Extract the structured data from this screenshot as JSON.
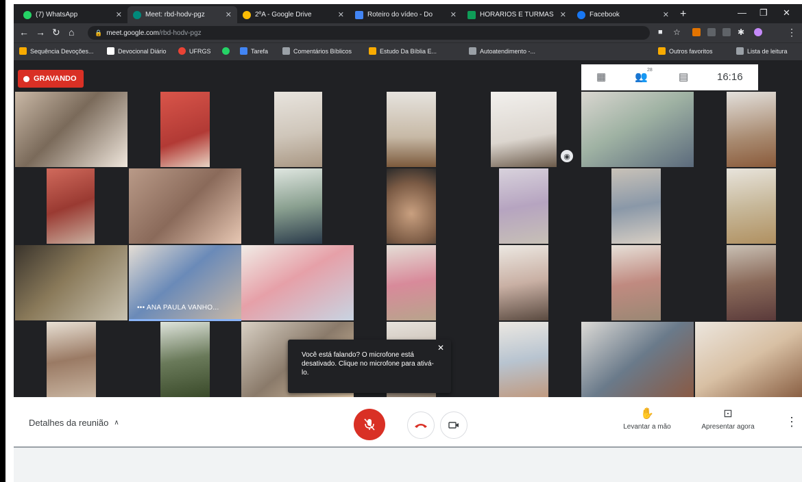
{
  "tabs": [
    {
      "label": "(7) WhatsApp",
      "color": "#25d366",
      "active": false
    },
    {
      "label": "Meet: rbd-hodv-pgz",
      "color": "#00897b",
      "active": true
    },
    {
      "label": "2ºA - Google Drive",
      "color": "#fbbc04",
      "active": false
    },
    {
      "label": "Roteiro do vídeo - Do",
      "color": "#4285f4",
      "active": false
    },
    {
      "label": "HORÁRIOS E TURMAS",
      "color": "#0f9d58",
      "active": false
    },
    {
      "label": "Facebook",
      "color": "#1877f2",
      "active": false
    }
  ],
  "address": {
    "host": "meet.google.com",
    "path": "/rbd-hodv-pgz"
  },
  "bookmarks": [
    {
      "label": "Sequência Devoções...",
      "color": "#f9ab00"
    },
    {
      "label": "Devocional Diário",
      "color": "#ffffff"
    },
    {
      "label": "UFRGS",
      "color": "#ea4335"
    },
    {
      "label": "",
      "color": "#25d366"
    },
    {
      "label": "Tarefa",
      "color": "#4285f4"
    },
    {
      "label": "Comentários Bíblicos",
      "color": "#9aa0a6"
    },
    {
      "label": "Estudo Da Bíblia E...",
      "color": "#f9ab00"
    },
    {
      "label": "Autoatendimento -...",
      "color": "#9aa0a6"
    },
    {
      "label": "Outros favoritos",
      "color": "#f9ab00"
    },
    {
      "label": "Lista de leitura",
      "color": "#9aa0a6"
    }
  ],
  "meet": {
    "recording_label": "GRAVANDO",
    "participant_count": "28",
    "clock": "16:16",
    "speaker_name": "••• ANA PAULA VANHO...",
    "mic_tooltip": "Você está falando? O microfone está desativado. Clique no microfone para ativá-lo."
  },
  "controls": {
    "details_label": "Detalhes da reunião",
    "raise_hand_label": "Levantar a mão",
    "present_label": "Apresentar agora"
  },
  "icons": {
    "mic": "mic-off-icon",
    "hangup": "hangup-icon",
    "camera": "camera-icon",
    "hand": "hand-icon",
    "present": "present-icon",
    "more": "more-icon"
  }
}
